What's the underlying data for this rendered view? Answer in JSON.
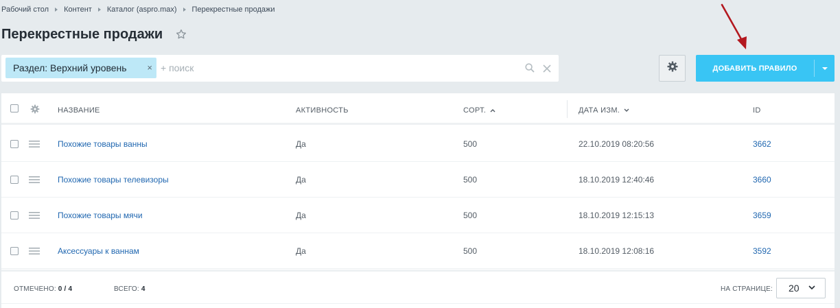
{
  "breadcrumb": [
    "Рабочий стол",
    "Контент",
    "Каталог (aspro.max)",
    "Перекрестные продажи"
  ],
  "page": {
    "title": "Перекрестные продажи",
    "star_icon": "star-outline-icon"
  },
  "filter": {
    "chip_label": "Раздел: Верхний уровень",
    "chip_close": "×",
    "search_placeholder": "+ поиск",
    "search_value": ""
  },
  "toolbar": {
    "settings_icon": "gear-icon",
    "add_button_label": "ДОБАВИТЬ ПРАВИЛО"
  },
  "colors": {
    "accent": "#39c5f4",
    "link": "#2067b0",
    "chip_bg": "#bde8f7",
    "annotation": "#b3181f"
  },
  "table": {
    "columns": {
      "name": "НАЗВАНИЕ",
      "active": "АКТИВНОСТЬ",
      "sort": "СОРТ.",
      "date": "ДАТА ИЗМ.",
      "id": "ID"
    },
    "rows": [
      {
        "name": "Похожие товары ванны",
        "active": "Да",
        "sort": "500",
        "date": "22.10.2019 08:20:56",
        "id": "3662"
      },
      {
        "name": "Похожие товары телевизоры",
        "active": "Да",
        "sort": "500",
        "date": "18.10.2019 12:40:46",
        "id": "3660"
      },
      {
        "name": "Похожие товары мячи",
        "active": "Да",
        "sort": "500",
        "date": "18.10.2019 12:15:13",
        "id": "3659"
      },
      {
        "name": "Аксессуары к ваннам",
        "active": "Да",
        "sort": "500",
        "date": "18.10.2019 12:08:16",
        "id": "3592"
      }
    ]
  },
  "footer": {
    "selected_label": "ОТМЕЧЕНО:",
    "selected_value": "0 / 4",
    "total_label": "ВСЕГО:",
    "total_value": "4",
    "per_page_label": "НА СТРАНИЦЕ:",
    "per_page_value": "20"
  }
}
